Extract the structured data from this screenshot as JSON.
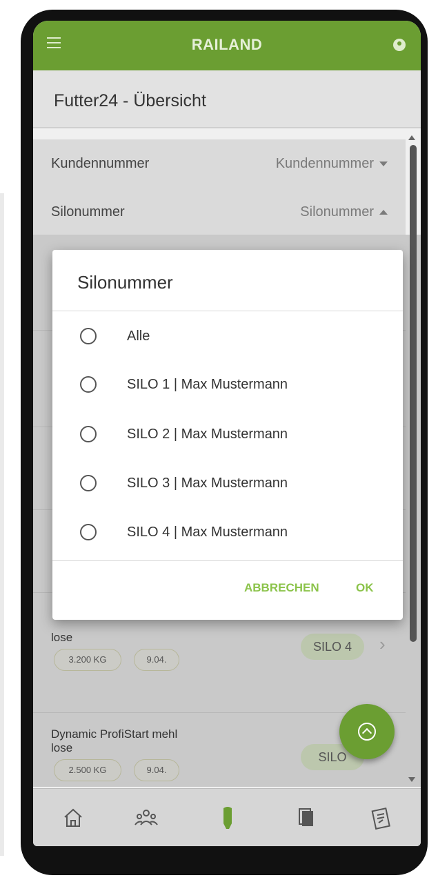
{
  "app": {
    "title": "RAILAND"
  },
  "page": {
    "title": "Futter24 - Übersicht"
  },
  "filters": [
    {
      "label": "Kundennummer",
      "value": "Kundennummer"
    },
    {
      "label": "Silonummer",
      "value": "Silonummer"
    }
  ],
  "list": [
    {
      "name_line1": "",
      "name_line2": "lose",
      "amount": "3.200 KG",
      "date": "9.04.",
      "silo": "SILO 4"
    },
    {
      "name_line1": "Dynamic ProfiStart mehl",
      "name_line2": "lose",
      "amount": "2.500 KG",
      "date": "9.04.",
      "silo": "SILO"
    }
  ],
  "dialog": {
    "title": "Silonummer",
    "options": [
      "Alle",
      "SILO 1 | Max Mustermann",
      "SILO 2 | Max Mustermann",
      "SILO 3 | Max Mustermann",
      "SILO 4 | Max Mustermann"
    ],
    "cancel_label": "ABBRECHEN",
    "ok_label": "OK"
  },
  "bottom_nav": [
    "home-icon",
    "users-icon",
    "silo-icon",
    "documents-icon",
    "invoice-icon"
  ],
  "colors": {
    "brand": "#6b9e32",
    "accent": "#8bc34a"
  }
}
